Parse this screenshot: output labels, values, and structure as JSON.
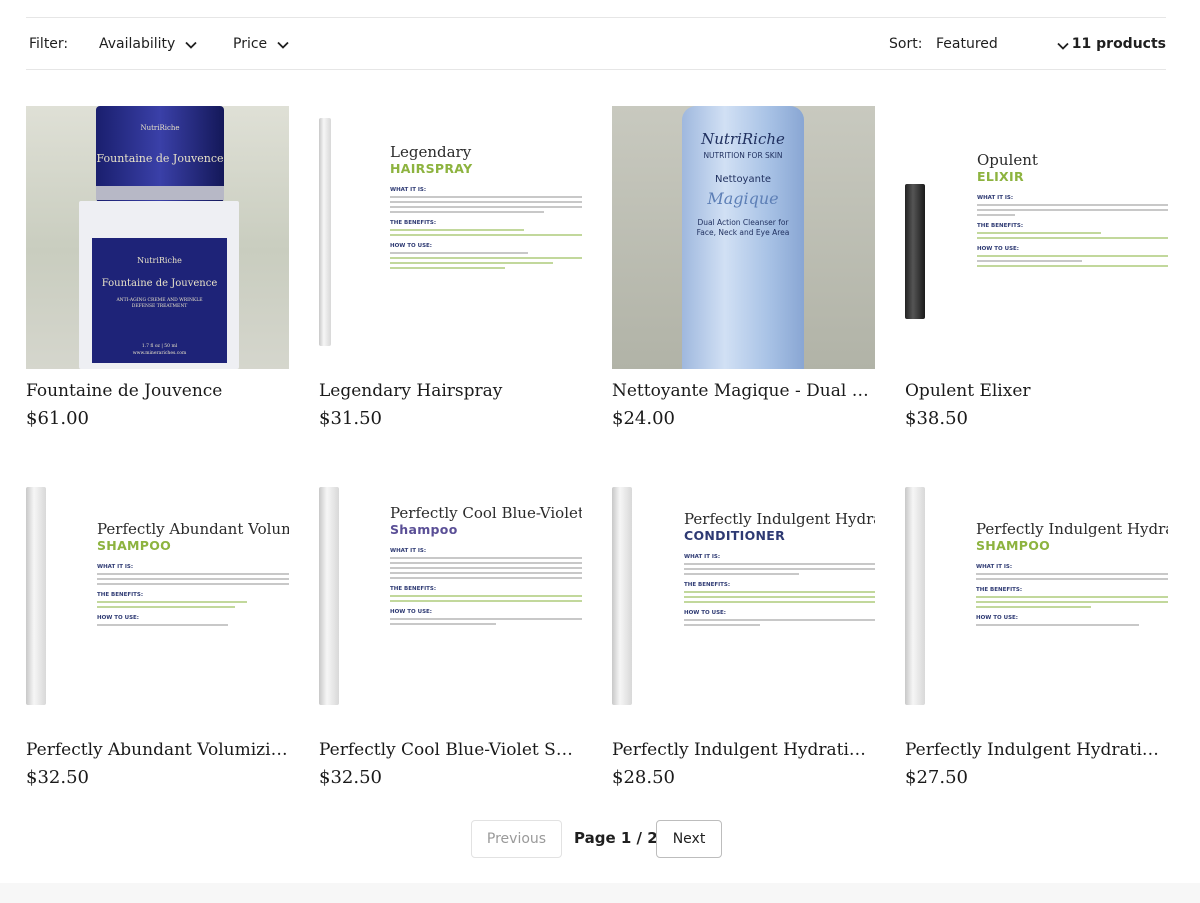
{
  "filters": {
    "filter_label": "Filter:",
    "availability_label": "Availability",
    "price_label": "Price",
    "sort_label": "Sort:",
    "sort_value": "Featured",
    "product_count": "11 products"
  },
  "products": [
    {
      "title": "Fountaine de Jouvence",
      "price": "$61.00",
      "image": {
        "brand": "NutriRiche",
        "name": "Fountaine de Jouvence",
        "sub": "ANTI-AGING CREME AND WRINKLE DEFENSE TREATMENT",
        "size": "1.7 fl oz | 50 ml",
        "url": "www.minerariches.com"
      }
    },
    {
      "title": "Legendary Hairspray",
      "price": "$31.50",
      "image": {
        "line1": "Legendary",
        "line2": "HAIRSPRAY",
        "s1": "WHAT IT IS:",
        "s2": "THE BENEFITS:",
        "s3": "HOW TO USE:"
      }
    },
    {
      "title": "Nettoyante Magique - Dual Acti…",
      "price": "$24.00",
      "image": {
        "brand": "NutriRiche",
        "tag": "NUTRITION FOR SKIN",
        "name": "Nettoyante",
        "script": "Magique",
        "desc": "Dual Action Cleanser for Face, Neck and Eye Area"
      }
    },
    {
      "title": "Opulent Elixer",
      "price": "$38.50",
      "image": {
        "line1": "Opulent",
        "line2": "ELIXIR",
        "s1": "WHAT IT IS:",
        "s2": "THE BENEFITS:",
        "s3": "HOW TO USE:"
      }
    },
    {
      "title": "Perfectly Abundant Volumizing …",
      "price": "$32.50",
      "image": {
        "line1": "Perfectly Abundant Volumizin",
        "line2": "SHAMPOO",
        "s1": "WHAT IT IS:",
        "s2": "THE BENEFITS:",
        "s3": "HOW TO USE:"
      }
    },
    {
      "title": "Perfectly Cool Blue-Violet Sham…",
      "price": "$32.50",
      "image": {
        "line1": "Perfectly Cool Blue-Violet",
        "line2": "Shampoo",
        "s1": "WHAT IT IS:",
        "s2": "THE BENEFITS:",
        "s3": "HOW TO USE:"
      }
    },
    {
      "title": "Perfectly Indulgent Hydrating C…",
      "price": "$28.50",
      "image": {
        "line1": "Perfectly Indulgent Hydrating",
        "line2": "CONDITIONER",
        "s1": "WHAT IT IS:",
        "s2": "THE BENEFITS:",
        "s3": "HOW TO USE:"
      }
    },
    {
      "title": "Perfectly Indulgent Hydrating S…",
      "price": "$27.50",
      "image": {
        "line1": "Perfectly Indulgent Hydrating",
        "line2": "SHAMPOO",
        "s1": "WHAT IT IS:",
        "s2": "THE BENEFITS:",
        "s3": "HOW TO USE:"
      }
    }
  ],
  "pagination": {
    "previous_label": "Previous",
    "page_info": "Page 1 / 2",
    "next_label": "Next"
  },
  "colors": {
    "accent_green": "#8db33f",
    "accent_navy": "#2e3a73",
    "accent_violet": "#5a4f96"
  }
}
